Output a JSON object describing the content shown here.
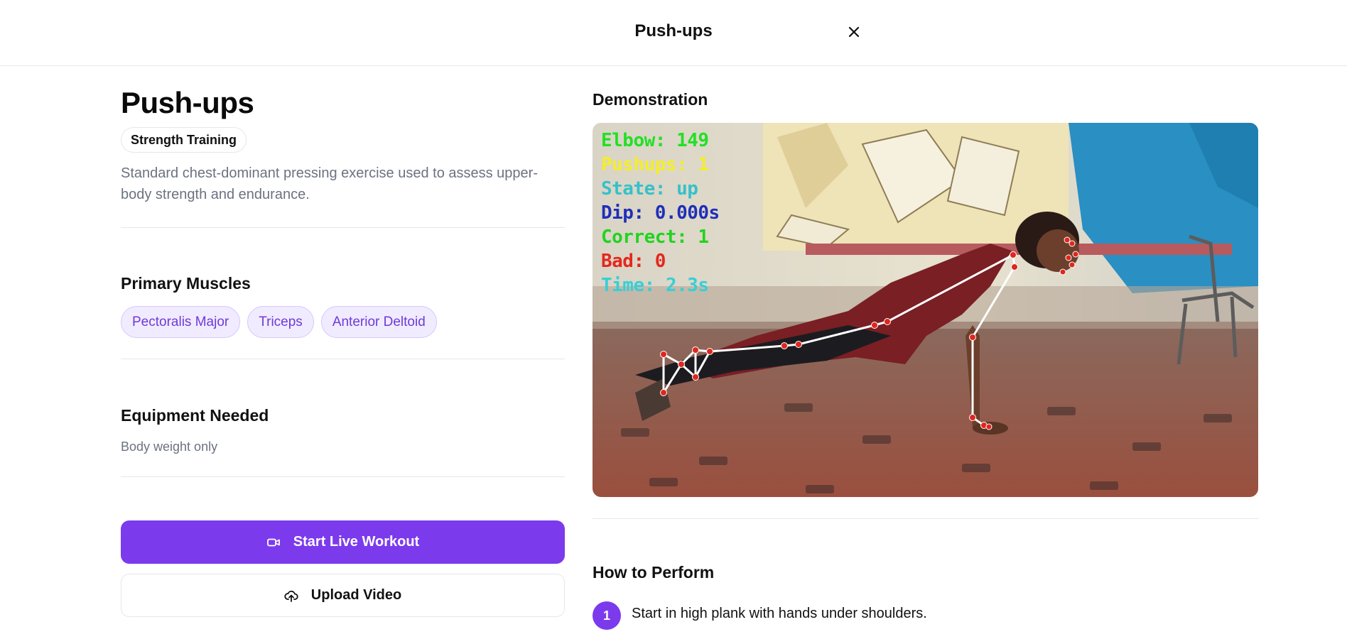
{
  "modal": {
    "title": "Push-ups",
    "close_icon": "close-icon"
  },
  "exercise": {
    "name": "Push-ups",
    "category": "Strength Training",
    "description": "Standard chest-dominant pressing exercise used to assess upper-body strength and endurance."
  },
  "muscles": {
    "heading": "Primary Muscles",
    "items": [
      "Pectoralis Major",
      "Triceps",
      "Anterior Deltoid"
    ]
  },
  "equipment": {
    "heading": "Equipment Needed",
    "value": "Body weight only"
  },
  "actions": {
    "start_label": "Start Live Workout",
    "start_icon": "video-camera-icon",
    "upload_label": "Upload Video",
    "upload_icon": "cloud-upload-icon"
  },
  "demo": {
    "heading": "Demonstration",
    "overlay": {
      "elbow": "Elbow: 149",
      "pushups": "Pushups: 1",
      "state": "State: up",
      "dip": "Dip: 0.000s",
      "correct": "Correct: 1",
      "bad": "Bad: 0",
      "time": "Time: 2.3s"
    }
  },
  "instructions": {
    "heading": "How to Perform",
    "steps": [
      {
        "number": "1",
        "text": "Start in high plank with hands under shoulders."
      }
    ]
  },
  "colors": {
    "accent": "#7c3aed",
    "chip_bg": "#f1ebff",
    "chip_text": "#6d3bd8"
  }
}
